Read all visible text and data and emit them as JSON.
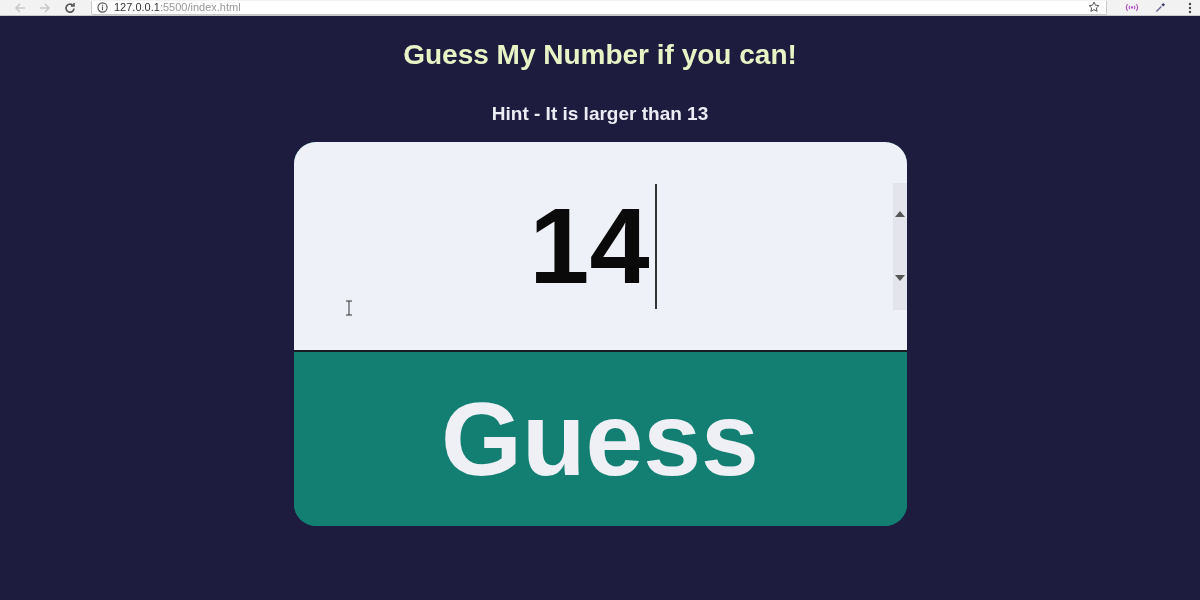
{
  "browser": {
    "back": {
      "disabled": true
    },
    "forward": {
      "disabled": true
    },
    "url": {
      "host": "127.0.0.1",
      "path": ":5500/index.html"
    }
  },
  "title": "Guess My Number if you can!",
  "hint": "Hint - It is larger than 13",
  "guess_field": {
    "value": "14"
  },
  "guess_button": {
    "label": "Guess"
  }
}
